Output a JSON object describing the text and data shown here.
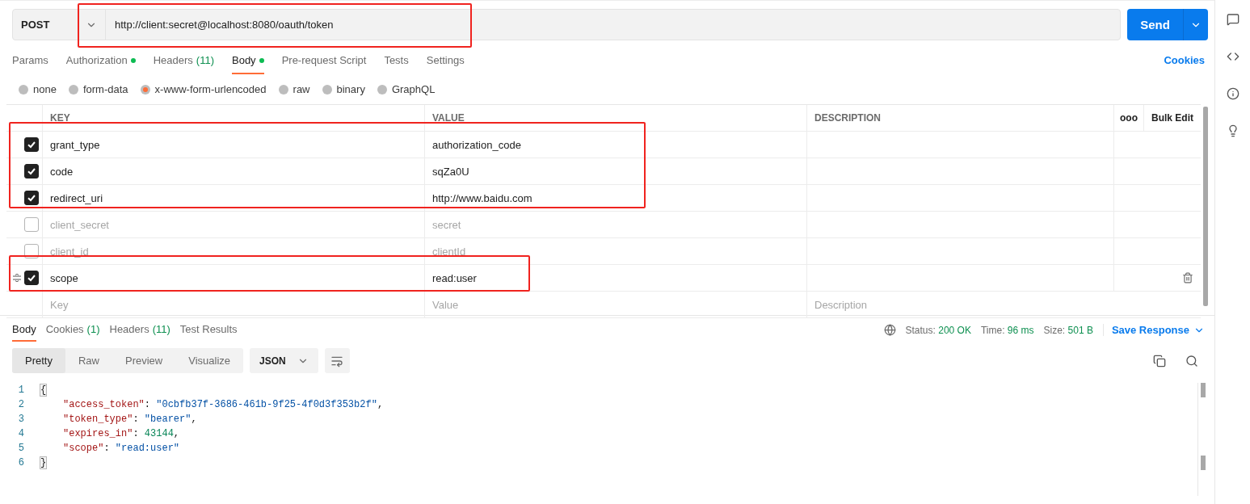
{
  "request": {
    "method": "POST",
    "url": "http://client:secret@localhost:8080/oauth/token",
    "url_highlighted": true,
    "send_label": "Send"
  },
  "request_tabs": [
    {
      "label": "Params",
      "dot": false,
      "selected": false
    },
    {
      "label": "Authorization",
      "dot": true,
      "selected": false
    },
    {
      "label": "Headers",
      "count": "(11)",
      "dot": false,
      "selected": false
    },
    {
      "label": "Body",
      "dot": true,
      "selected": true
    },
    {
      "label": "Pre-request Script",
      "dot": false,
      "selected": false
    },
    {
      "label": "Tests",
      "dot": false,
      "selected": false
    },
    {
      "label": "Settings",
      "dot": false,
      "selected": false
    }
  ],
  "cookies_link": "Cookies",
  "body_types": [
    {
      "label": "none",
      "selected": false
    },
    {
      "label": "form-data",
      "selected": false
    },
    {
      "label": "x-www-form-urlencoded",
      "selected": true
    },
    {
      "label": "raw",
      "selected": false
    },
    {
      "label": "binary",
      "selected": false
    },
    {
      "label": "GraphQL",
      "selected": false
    }
  ],
  "table": {
    "columns": [
      "KEY",
      "VALUE",
      "DESCRIPTION"
    ],
    "more_label": "ooo",
    "bulk_edit": "Bulk Edit",
    "rows": [
      {
        "key": "grant_type",
        "value": "authorization_code",
        "checked": true,
        "hovered": false,
        "highlighted": true
      },
      {
        "key": "code",
        "value": "sqZa0U",
        "checked": true,
        "hovered": false,
        "highlighted": true
      },
      {
        "key": "redirect_uri",
        "value": "http://www.baidu.com",
        "checked": true,
        "hovered": false,
        "highlighted": true
      },
      {
        "key": "client_secret",
        "value": "secret",
        "checked": false,
        "hovered": false,
        "highlighted": false
      },
      {
        "key": "client_id",
        "value": "clientId",
        "checked": false,
        "hovered": false,
        "highlighted": false
      },
      {
        "key": "scope",
        "value": "read:user",
        "checked": true,
        "hovered": true,
        "highlighted": true
      }
    ],
    "new_row": {
      "key": "Key",
      "value": "Value",
      "description": "Description"
    }
  },
  "response": {
    "tabs": [
      {
        "label": "Body",
        "selected": true
      },
      {
        "label": "Cookies",
        "count": "(1)",
        "selected": false
      },
      {
        "label": "Headers",
        "count": "(11)",
        "selected": false
      },
      {
        "label": "Test Results",
        "selected": false
      }
    ],
    "stats": [
      {
        "label": "Status:",
        "value": "200 OK"
      },
      {
        "label": "Time:",
        "value": "96 ms"
      },
      {
        "label": "Size:",
        "value": "501 B"
      }
    ],
    "save_response": "Save Response",
    "view_modes": [
      {
        "label": "Pretty",
        "selected": true
      },
      {
        "label": "Raw",
        "selected": false
      },
      {
        "label": "Preview",
        "selected": false
      },
      {
        "label": "Visualize",
        "selected": false
      }
    ],
    "format": "JSON",
    "code_lines": [
      {
        "number": "1",
        "tokens": [
          {
            "kind": "bracket",
            "text": "{"
          }
        ]
      },
      {
        "number": "2",
        "tokens": [
          {
            "kind": "key",
            "text": "\"access_token\""
          },
          {
            "kind": "punct",
            "text": ": "
          },
          {
            "kind": "string",
            "text": "\"0cbfb37f-3686-461b-9f25-4f0d3f353b2f\""
          },
          {
            "kind": "punct",
            "text": ","
          }
        ]
      },
      {
        "number": "3",
        "tokens": [
          {
            "kind": "key",
            "text": "\"token_type\""
          },
          {
            "kind": "punct",
            "text": ": "
          },
          {
            "kind": "string",
            "text": "\"bearer\""
          },
          {
            "kind": "punct",
            "text": ","
          }
        ]
      },
      {
        "number": "4",
        "tokens": [
          {
            "kind": "key",
            "text": "\"expires_in\""
          },
          {
            "kind": "punct",
            "text": ": "
          },
          {
            "kind": "number",
            "text": "43144"
          },
          {
            "kind": "punct",
            "text": ","
          }
        ]
      },
      {
        "number": "5",
        "tokens": [
          {
            "kind": "key",
            "text": "\"scope\""
          },
          {
            "kind": "punct",
            "text": ": "
          },
          {
            "kind": "string",
            "text": "\"read:user\""
          }
        ]
      },
      {
        "number": "6",
        "tokens": [
          {
            "kind": "bracket",
            "text": "}"
          }
        ]
      }
    ]
  }
}
